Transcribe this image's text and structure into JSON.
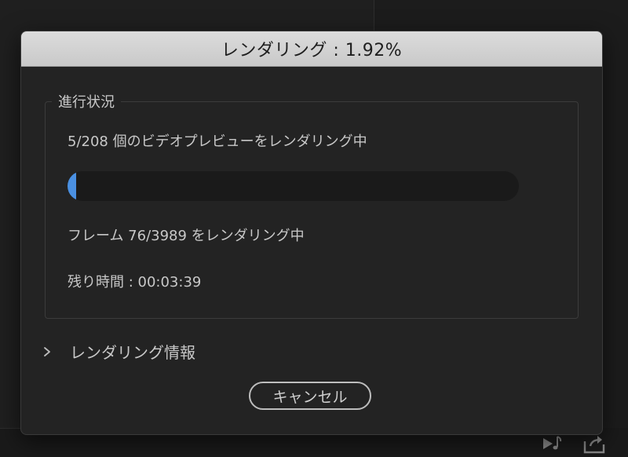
{
  "dialog": {
    "title": "レンダリング : 1.92%",
    "progress_group_label": "進行状況",
    "previews_status": "5/208 個のビデオプレビューをレンダリング中",
    "progress_fraction": 0.0192,
    "frames_status": "フレーム 76/3989 をレンダリング中",
    "time_remaining": "残り時間 : 00:03:39",
    "details_label": "レンダリング情報",
    "cancel_label": "キャンセル"
  },
  "icons": {
    "details_toggle": "chevron-right-icon",
    "audio_track": "play-audio-icon",
    "export": "export-icon"
  },
  "colors": {
    "accent": "#4a90e2",
    "dialog_bg": "#232323",
    "titlebar_bg": "#d4d4d4"
  }
}
